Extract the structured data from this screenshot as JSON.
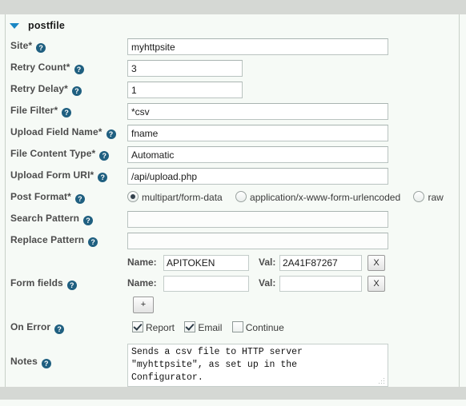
{
  "panel": {
    "title": "postfile",
    "disclosure_icon": "triangle-down-icon",
    "expanded": true
  },
  "help_icon_glyph": "?",
  "colors": {
    "help_icon": "#1f5f80",
    "disclosure": "#1b87c4",
    "panel_background": "#f6faf6",
    "chrome_bar": "#d5d8d4",
    "label_text": "#4c4c4c",
    "input_border": "#b9c3c0"
  },
  "fields": {
    "site": {
      "label": "Site*",
      "value": "myhttpsite",
      "placeholder": ""
    },
    "retry_count": {
      "label": "Retry Count*",
      "value": "3",
      "placeholder": ""
    },
    "retry_delay": {
      "label": "Retry Delay*",
      "value": "1",
      "placeholder": ""
    },
    "file_filter": {
      "label": "File Filter*",
      "value": "*csv",
      "placeholder": ""
    },
    "upload_field": {
      "label": "Upload Field Name*",
      "value": "fname",
      "placeholder": ""
    },
    "content_type": {
      "label": "File Content Type*",
      "value": "Automatic",
      "placeholder": ""
    },
    "form_uri": {
      "label": "Upload Form URI*",
      "value": "/api/upload.php",
      "placeholder": ""
    },
    "search_pattern": {
      "label": "Search Pattern",
      "value": "",
      "placeholder": ""
    },
    "replace_pattern": {
      "label": "Replace Pattern",
      "value": "",
      "placeholder": ""
    },
    "form_fields": {
      "label": "Form fields"
    },
    "on_error": {
      "label": "On Error"
    },
    "notes": {
      "label": "Notes"
    }
  },
  "post_format": {
    "label": "Post Format*",
    "options": [
      {
        "label": "multipart/form-data",
        "checked": true
      },
      {
        "label": "application/x-www-form-urlencoded",
        "checked": false
      },
      {
        "label": "raw",
        "checked": false
      }
    ]
  },
  "form_fields_rows": [
    {
      "name_label": "Name:",
      "name_value": "APITOKEN",
      "val_label": "Val:",
      "val_value": "2A41F87267",
      "remove_label": "X"
    },
    {
      "name_label": "Name:",
      "name_value": "",
      "val_label": "Val:",
      "val_value": "",
      "remove_label": "X"
    }
  ],
  "add_field_button": {
    "label": "+"
  },
  "on_error_options": [
    {
      "label": "Report",
      "checked": true
    },
    {
      "label": "Email",
      "checked": true
    },
    {
      "label": "Continue",
      "checked": false
    }
  ],
  "notes_text": "Sends a csv file to HTTP server\n\"myhttpsite\", as set up in the\nConfigurator."
}
